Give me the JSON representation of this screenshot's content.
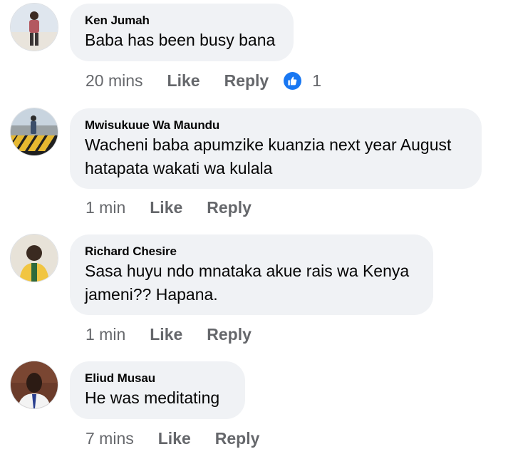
{
  "comments": [
    {
      "author": "Ken Jumah",
      "text": "Baba has been busy bana",
      "time": "20 mins",
      "like_label": "Like",
      "reply_label": "Reply",
      "reaction_icon": "like-reaction-icon",
      "reaction_count": "1",
      "avatar": "user-avatar"
    },
    {
      "author": "Mwisukuue Wa Maundu",
      "text": "Wacheni baba apumzike kuanzia next year August hatapata wakati wa kulala",
      "time": "1 min",
      "like_label": "Like",
      "reply_label": "Reply",
      "avatar": "user-avatar"
    },
    {
      "author": "Richard Chesire",
      "text": "Sasa huyu ndo mnataka akue rais wa Kenya jameni?? Hapana.",
      "time": "1 min",
      "like_label": "Like",
      "reply_label": "Reply",
      "avatar": "user-avatar"
    },
    {
      "author": "Eliud Musau",
      "text": "He was meditating",
      "time": "7 mins",
      "like_label": "Like",
      "reply_label": "Reply",
      "avatar": "user-avatar"
    }
  ],
  "colors": {
    "bubble": "#f0f2f5",
    "meta_text": "#65676b",
    "like_reaction": "#1877f2"
  }
}
